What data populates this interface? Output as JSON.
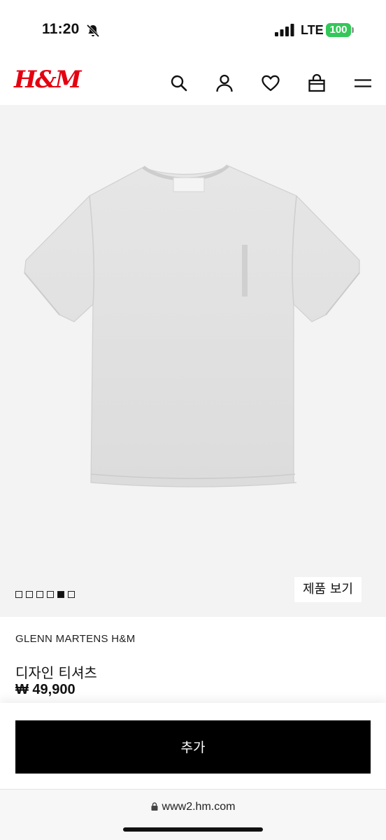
{
  "status_bar": {
    "time": "11:20",
    "network": "LTE",
    "battery": "100",
    "battery_color": "#34c759"
  },
  "header": {
    "logo": "H&M",
    "logo_color": "#e50010",
    "icons": [
      "search-icon",
      "user-icon",
      "heart-icon",
      "bag-icon",
      "menu-icon"
    ]
  },
  "gallery": {
    "image_count": 6,
    "active_index": 4,
    "view_product_label": "제품 보기"
  },
  "product": {
    "brand": "GLENN MARTENS H&M",
    "name": "디자인 티셔츠",
    "price": "₩ 49,900"
  },
  "actions": {
    "add_label": "추가"
  },
  "browser": {
    "url": "www2.hm.com"
  }
}
